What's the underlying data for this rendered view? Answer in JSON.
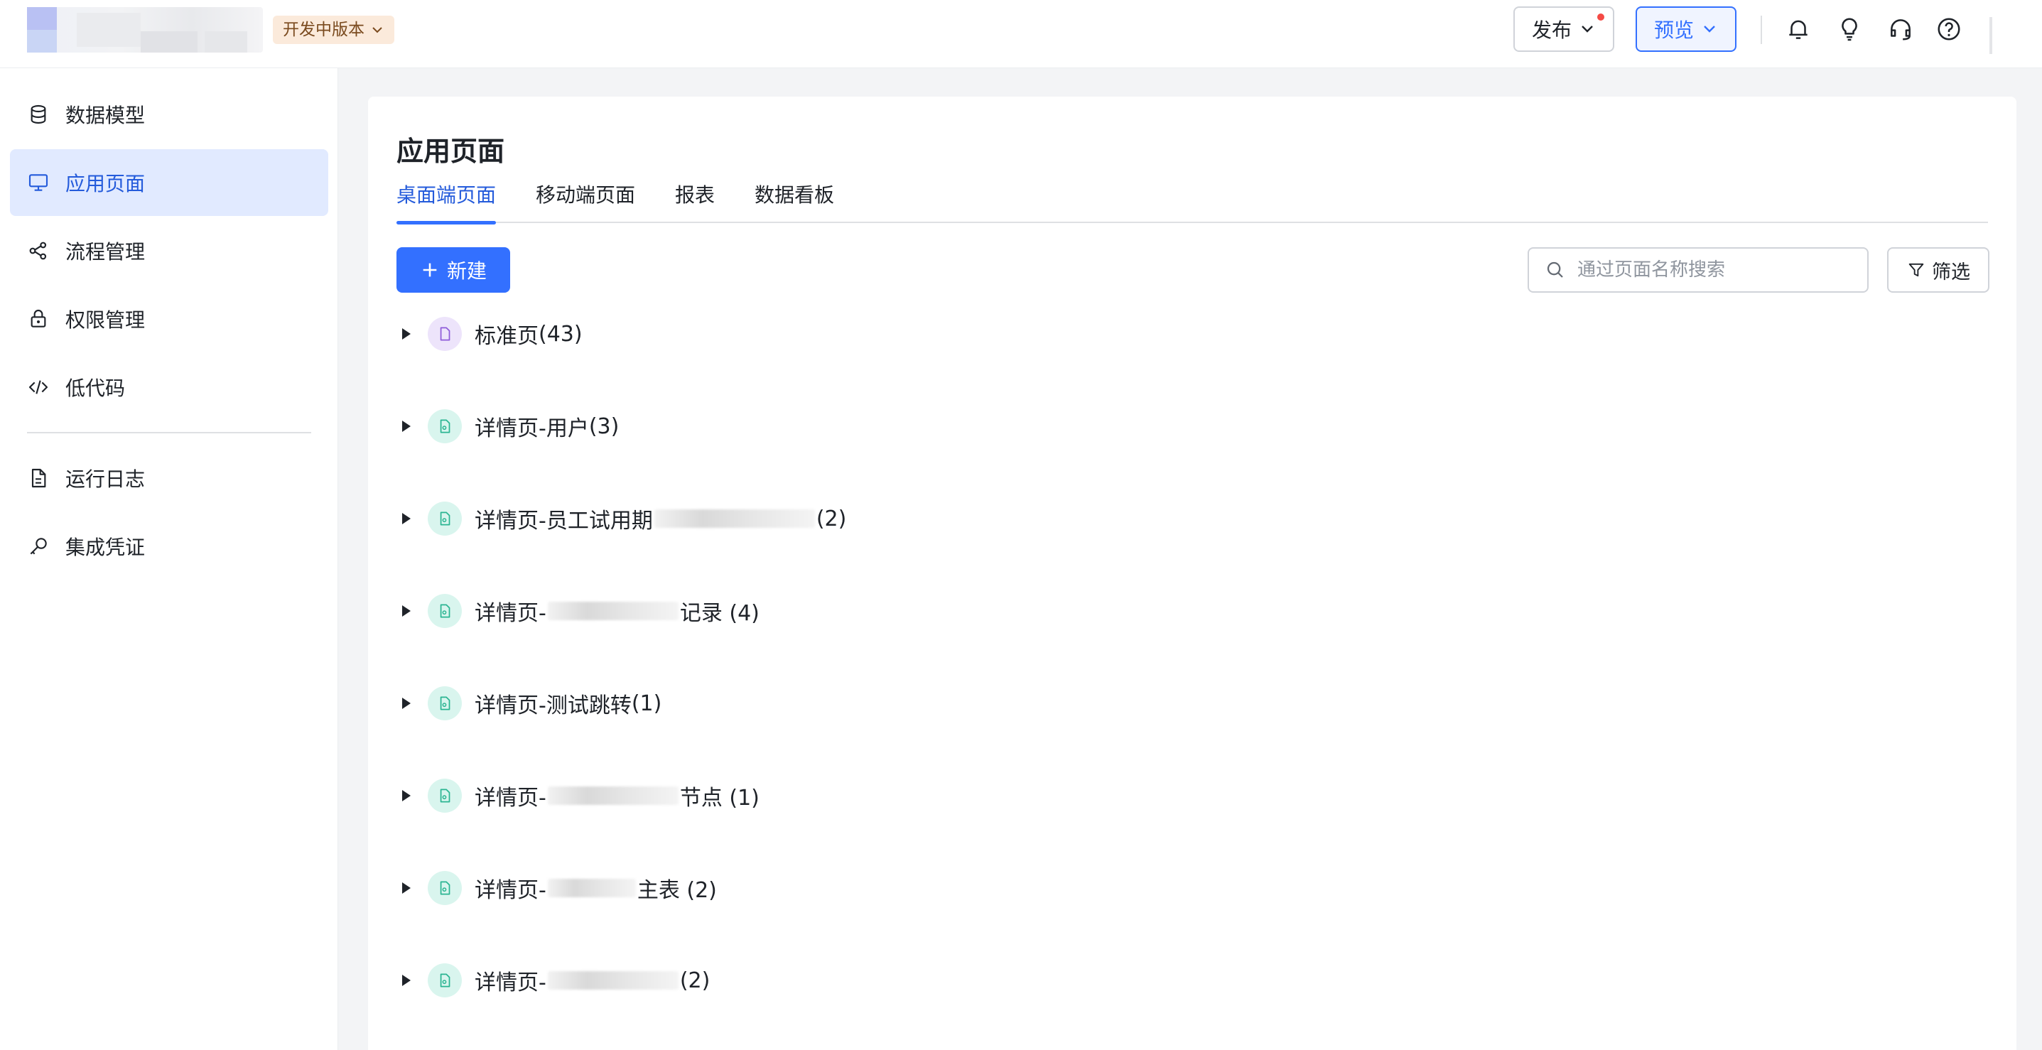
{
  "header": {
    "env_badge": "开发中版本",
    "publish_label": "发布",
    "preview_label": "预览",
    "icons": [
      "bell-icon",
      "bulb-icon",
      "headset-icon",
      "help-icon"
    ]
  },
  "sidebar": {
    "items": [
      {
        "label": "数据模型",
        "icon": "database-icon",
        "active": false
      },
      {
        "label": "应用页面",
        "icon": "monitor-icon",
        "active": true
      },
      {
        "label": "流程管理",
        "icon": "flow-icon",
        "active": false
      },
      {
        "label": "权限管理",
        "icon": "lock-icon",
        "active": false
      },
      {
        "label": "低代码",
        "icon": "code-icon",
        "active": false
      },
      {
        "label": "运行日志",
        "icon": "log-icon",
        "active": false
      },
      {
        "label": "集成凭证",
        "icon": "key-icon",
        "active": false
      }
    ]
  },
  "main": {
    "title": "应用页面",
    "tabs": [
      {
        "label": "桌面端页面",
        "active": true
      },
      {
        "label": "移动端页面",
        "active": false
      },
      {
        "label": "报表",
        "active": false
      },
      {
        "label": "数据看板",
        "active": false
      }
    ],
    "new_button": "新建",
    "search_placeholder": "通过页面名称搜索",
    "filter_button": "筛选",
    "groups": [
      {
        "type": "standard",
        "prefix": "标准页",
        "suffix": " (43)"
      },
      {
        "type": "detail",
        "prefix": "详情页-用户",
        "suffix": " (3)"
      },
      {
        "type": "detail",
        "prefix": "详情页-员工试用期",
        "suffix": " (2)"
      },
      {
        "type": "detail",
        "prefix": "详情页-",
        "suffix": "记录 (4)"
      },
      {
        "type": "detail",
        "prefix": "详情页-测试跳转",
        "suffix": " (1)"
      },
      {
        "type": "detail",
        "prefix": "详情页-",
        "suffix": "节点 (1)"
      },
      {
        "type": "detail",
        "prefix": "详情页-",
        "suffix": "主表 (2)"
      },
      {
        "type": "detail",
        "prefix": "详情页-",
        "suffix": " (2)"
      }
    ]
  },
  "colors": {
    "accent": "#3370ff",
    "active_nav_bg": "#e1eaff",
    "standard_icon_bg": "#ede4fb",
    "detail_icon_bg": "#d9f5ee"
  }
}
